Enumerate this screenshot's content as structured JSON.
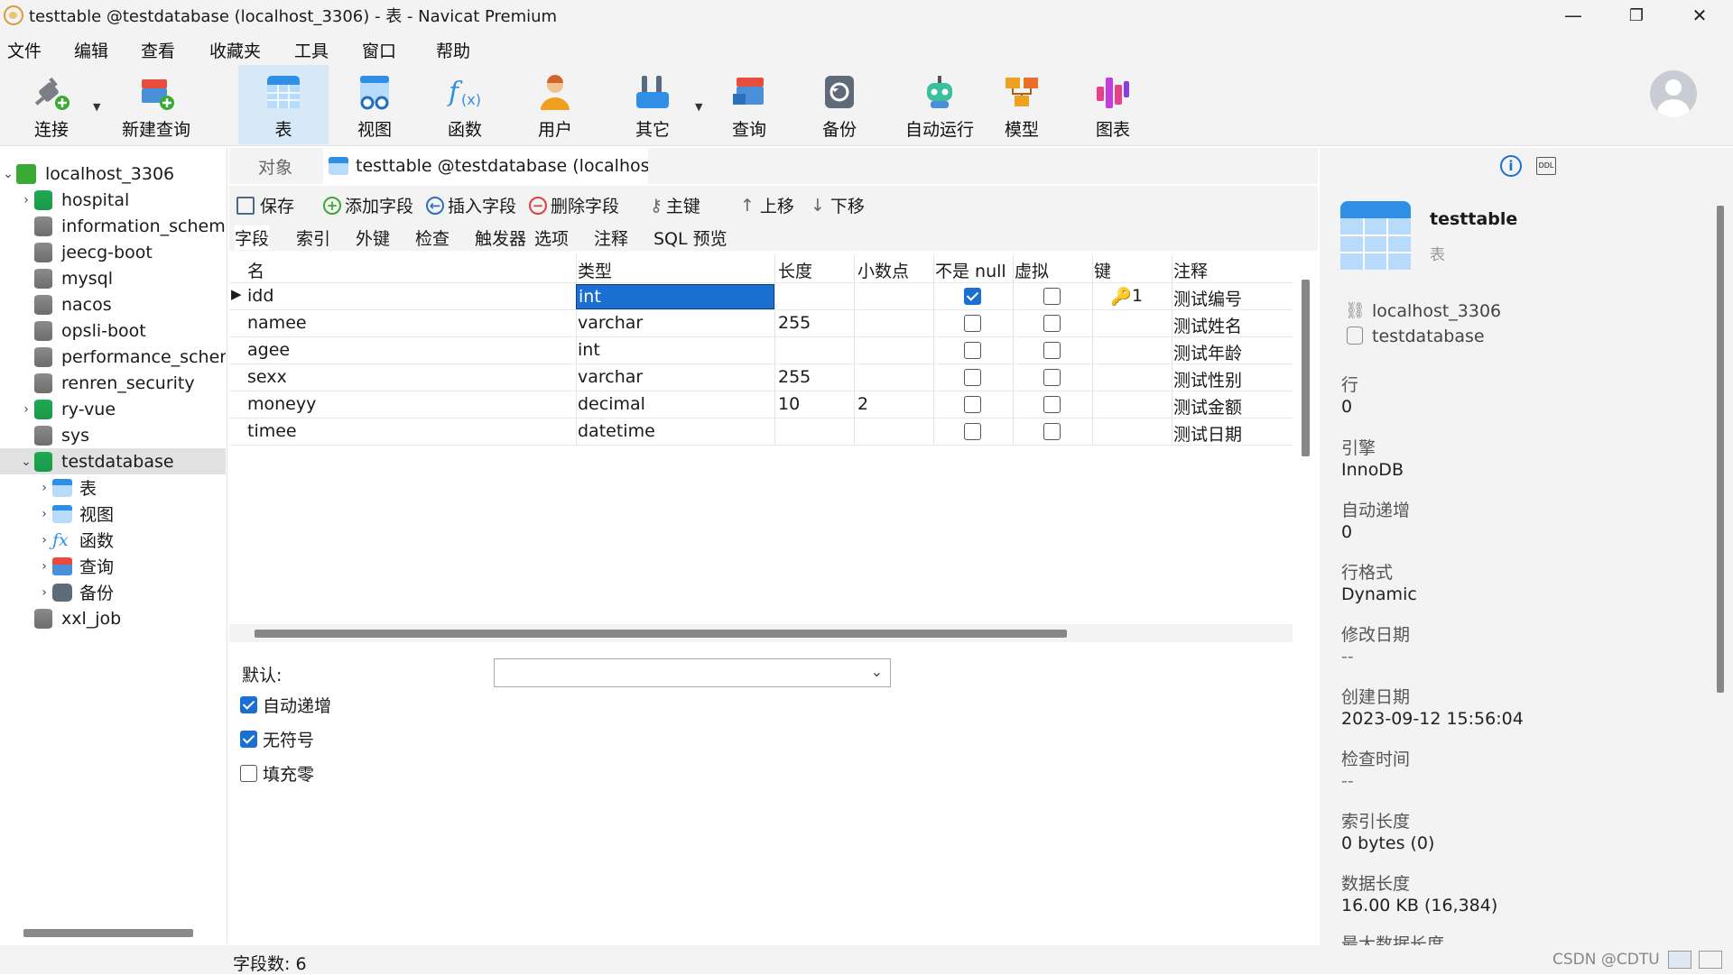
{
  "window": {
    "title": "testtable @testdatabase (localhost_3306) - 表 - Navicat Premium",
    "minimize": "—",
    "maximize": "❐",
    "close": "✕"
  },
  "menu": [
    "文件",
    "编辑",
    "查看",
    "收藏夹",
    "工具",
    "窗口",
    "帮助"
  ],
  "toolbar": {
    "items": [
      {
        "label": "连接",
        "icon": "plug-icon"
      },
      {
        "label": "新建查询",
        "icon": "new-query-icon"
      },
      {
        "label": "表",
        "icon": "table-icon"
      },
      {
        "label": "视图",
        "icon": "view-icon"
      },
      {
        "label": "函数",
        "icon": "function-icon"
      },
      {
        "label": "用户",
        "icon": "user-icon"
      },
      {
        "label": "其它",
        "icon": "tools-icon"
      },
      {
        "label": "查询",
        "icon": "query-icon"
      },
      {
        "label": "备份",
        "icon": "backup-icon"
      },
      {
        "label": "自动运行",
        "icon": "robot-icon"
      },
      {
        "label": "模型",
        "icon": "model-icon"
      },
      {
        "label": "图表",
        "icon": "chart-icon"
      }
    ],
    "active": "表"
  },
  "tree": {
    "connection": "localhost_3306",
    "databases": [
      {
        "name": "hospital",
        "open": false,
        "color": "green"
      },
      {
        "name": "information_schema",
        "open": false,
        "color": "gray"
      },
      {
        "name": "jeecg-boot",
        "open": false,
        "color": "gray"
      },
      {
        "name": "mysql",
        "open": false,
        "color": "gray"
      },
      {
        "name": "nacos",
        "open": false,
        "color": "gray"
      },
      {
        "name": "opsli-boot",
        "open": false,
        "color": "gray"
      },
      {
        "name": "performance_schem",
        "open": false,
        "color": "gray"
      },
      {
        "name": "renren_security",
        "open": false,
        "color": "gray"
      },
      {
        "name": "ry-vue",
        "open": false,
        "color": "green"
      },
      {
        "name": "sys",
        "open": false,
        "color": "gray"
      },
      {
        "name": "testdatabase",
        "open": true,
        "color": "green"
      },
      {
        "name": "xxl_job",
        "open": false,
        "color": "gray"
      }
    ],
    "children": [
      "表",
      "视图",
      "函数",
      "查询",
      "备份"
    ]
  },
  "tabs": {
    "objects": "对象",
    "document": "testtable @testdatabase (localhost_..."
  },
  "actions": {
    "save": "保存",
    "add_field": "添加字段",
    "insert_field": "插入字段",
    "delete_field": "删除字段",
    "primary_key": "主键",
    "move_up": "上移",
    "move_down": "下移"
  },
  "subtabs": [
    "字段",
    "索引",
    "外键",
    "检查",
    "触发器",
    "选项",
    "注释",
    "SQL 预览"
  ],
  "grid": {
    "headers": [
      "名",
      "类型",
      "长度",
      "小数点",
      "不是 null",
      "虚拟",
      "键",
      "注释"
    ],
    "rows": [
      {
        "name": "idd",
        "type": "int",
        "length": "",
        "decimals": "",
        "not_null": true,
        "virtual": false,
        "key": "1",
        "comment": "测试编号"
      },
      {
        "name": "namee",
        "type": "varchar",
        "length": "255",
        "decimals": "",
        "not_null": false,
        "virtual": false,
        "key": "",
        "comment": "测试姓名"
      },
      {
        "name": "agee",
        "type": "int",
        "length": "",
        "decimals": "",
        "not_null": false,
        "virtual": false,
        "key": "",
        "comment": "测试年龄"
      },
      {
        "name": "sexx",
        "type": "varchar",
        "length": "255",
        "decimals": "",
        "not_null": false,
        "virtual": false,
        "key": "",
        "comment": "测试性别"
      },
      {
        "name": "moneyy",
        "type": "decimal",
        "length": "10",
        "decimals": "2",
        "not_null": false,
        "virtual": false,
        "key": "",
        "comment": "测试金额"
      },
      {
        "name": "timee",
        "type": "datetime",
        "length": "",
        "decimals": "",
        "not_null": false,
        "virtual": false,
        "key": "",
        "comment": "测试日期"
      }
    ]
  },
  "options": {
    "default_label": "默认:",
    "auto_increment": "自动递增",
    "unsigned": "无符号",
    "zerofill": "填充零"
  },
  "status": {
    "field_count": "字段数: 6",
    "watermark": "CSDN @CDTU"
  },
  "info": {
    "name": "testtable",
    "type": "表",
    "connection": "localhost_3306",
    "database": "testdatabase",
    "fields": [
      {
        "label": "行",
        "value": "0"
      },
      {
        "label": "引擎",
        "value": "InnoDB"
      },
      {
        "label": "自动递增",
        "value": "0"
      },
      {
        "label": "行格式",
        "value": "Dynamic"
      },
      {
        "label": "修改日期",
        "value": "--"
      },
      {
        "label": "创建日期",
        "value": "2023-09-12 15:56:04"
      },
      {
        "label": "检查时间",
        "value": "--"
      },
      {
        "label": "索引长度",
        "value": "0 bytes (0)"
      },
      {
        "label": "数据长度",
        "value": "16.00 KB (16,384)"
      },
      {
        "label": "最大数据长度",
        "value": ""
      }
    ]
  }
}
